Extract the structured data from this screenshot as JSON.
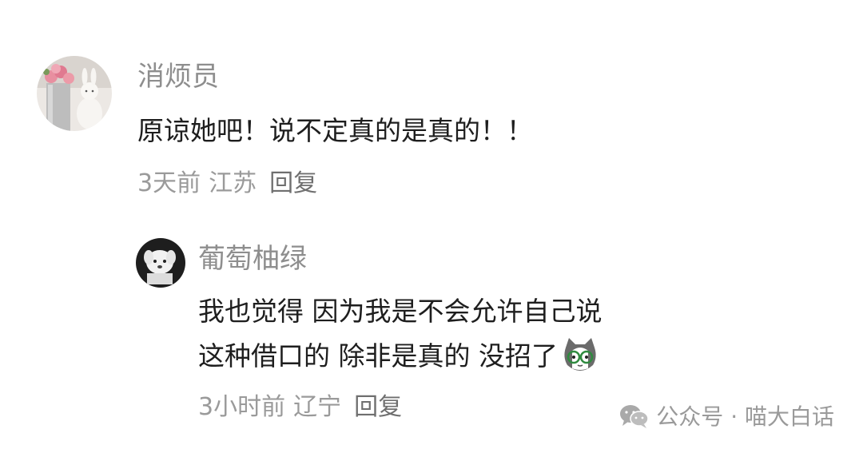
{
  "comment": {
    "avatar_icon": "rabbit-flowers-avatar",
    "username": "消烦员",
    "text": "原谅她吧！说不定真的是真的！！",
    "time": "3天前",
    "location": "江苏",
    "reply_label": "回复"
  },
  "reply": {
    "avatar_icon": "dog-avatar",
    "username": "葡萄柚绿",
    "text_line1": "我也觉得 因为我是不会允许自己说",
    "text_line2": "这种借口的 除非是真的 没招了",
    "emoji_icon": "cat-glasses-emoji",
    "time": "3小时前",
    "location": "辽宁",
    "reply_label": "回复"
  },
  "watermark": {
    "icon": "wechat-icon",
    "text": "公众号 · 喵大白话"
  }
}
